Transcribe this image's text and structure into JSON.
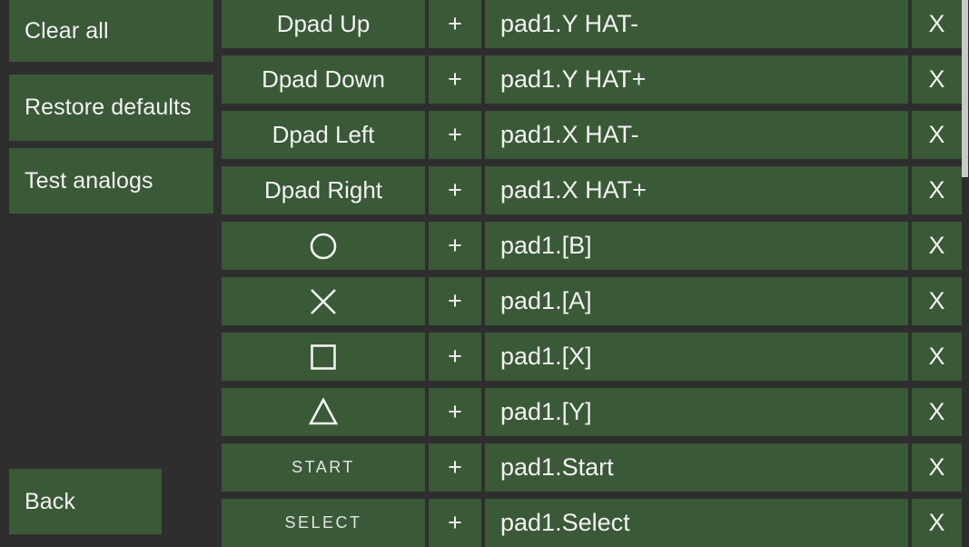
{
  "theme": {
    "background": "#2e2e2e",
    "panel_green": "#3a5937",
    "text": "#f2f2f2",
    "scrollbar": "#c9c9c9"
  },
  "sidebar": {
    "buttons": [
      {
        "id": "clear-all",
        "label": "Clear all"
      },
      {
        "id": "restore-defaults",
        "label": "Restore defaults"
      },
      {
        "id": "test-analogs",
        "label": "Test analogs"
      },
      {
        "id": "back",
        "label": "Back"
      }
    ]
  },
  "bindings": {
    "add_label": "+",
    "remove_label": "X",
    "rows": [
      {
        "control": "Dpad Up",
        "icon": null,
        "style": "text",
        "add": "+",
        "binding": "pad1.Y HAT-",
        "remove": "X"
      },
      {
        "control": "Dpad Down",
        "icon": null,
        "style": "text",
        "add": "+",
        "binding": "pad1.Y HAT+",
        "remove": "X"
      },
      {
        "control": "Dpad Left",
        "icon": null,
        "style": "text",
        "add": "+",
        "binding": "pad1.X HAT-",
        "remove": "X"
      },
      {
        "control": "Dpad Right",
        "icon": null,
        "style": "text",
        "add": "+",
        "binding": "pad1.X HAT+",
        "remove": "X"
      },
      {
        "control": "",
        "icon": "circle-icon",
        "style": "icon",
        "add": "+",
        "binding": "pad1.[B]",
        "remove": "X"
      },
      {
        "control": "",
        "icon": "cross-icon",
        "style": "icon",
        "add": "+",
        "binding": "pad1.[A]",
        "remove": "X"
      },
      {
        "control": "",
        "icon": "square-icon",
        "style": "icon",
        "add": "+",
        "binding": "pad1.[X]",
        "remove": "X"
      },
      {
        "control": "",
        "icon": "triangle-icon",
        "style": "icon",
        "add": "+",
        "binding": "pad1.[Y]",
        "remove": "X"
      },
      {
        "control": "START",
        "icon": null,
        "style": "small",
        "add": "+",
        "binding": "pad1.Start",
        "remove": "X"
      },
      {
        "control": "SELECT",
        "icon": null,
        "style": "small",
        "add": "+",
        "binding": "pad1.Select",
        "remove": "X"
      }
    ]
  },
  "scrollbar": {
    "thumb_top_pct": 0,
    "thumb_height_pct": 32.5
  }
}
